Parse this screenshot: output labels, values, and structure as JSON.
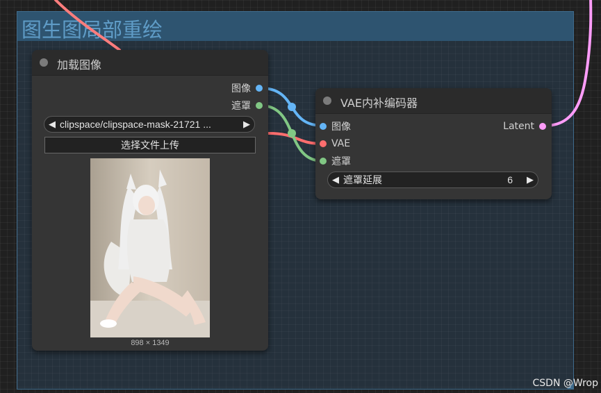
{
  "group": {
    "title": "图生图局部重绘"
  },
  "load_image_node": {
    "title": "加载图像",
    "outputs": [
      "图像",
      "遮罩"
    ],
    "image_combo": {
      "value": "clipspace/clipspace-mask-21721 ..."
    },
    "upload_button": "选择文件上传",
    "image_size": "898 × 1349"
  },
  "vae_node": {
    "title": "VAE内补编码器",
    "inputs": [
      "图像",
      "VAE",
      "遮罩"
    ],
    "output": "Latent",
    "grow_mask": {
      "label": "遮罩延展",
      "value": "6"
    }
  },
  "colors": {
    "image_slot": "#64b5f6",
    "mask_slot": "#81c784",
    "vae_slot": "#ff6e6e",
    "latent_slot": "#ff9cf9",
    "group_border": "#3f6b8c",
    "group_title": "#5f9cc7"
  },
  "watermark": "CSDN @Wrop"
}
